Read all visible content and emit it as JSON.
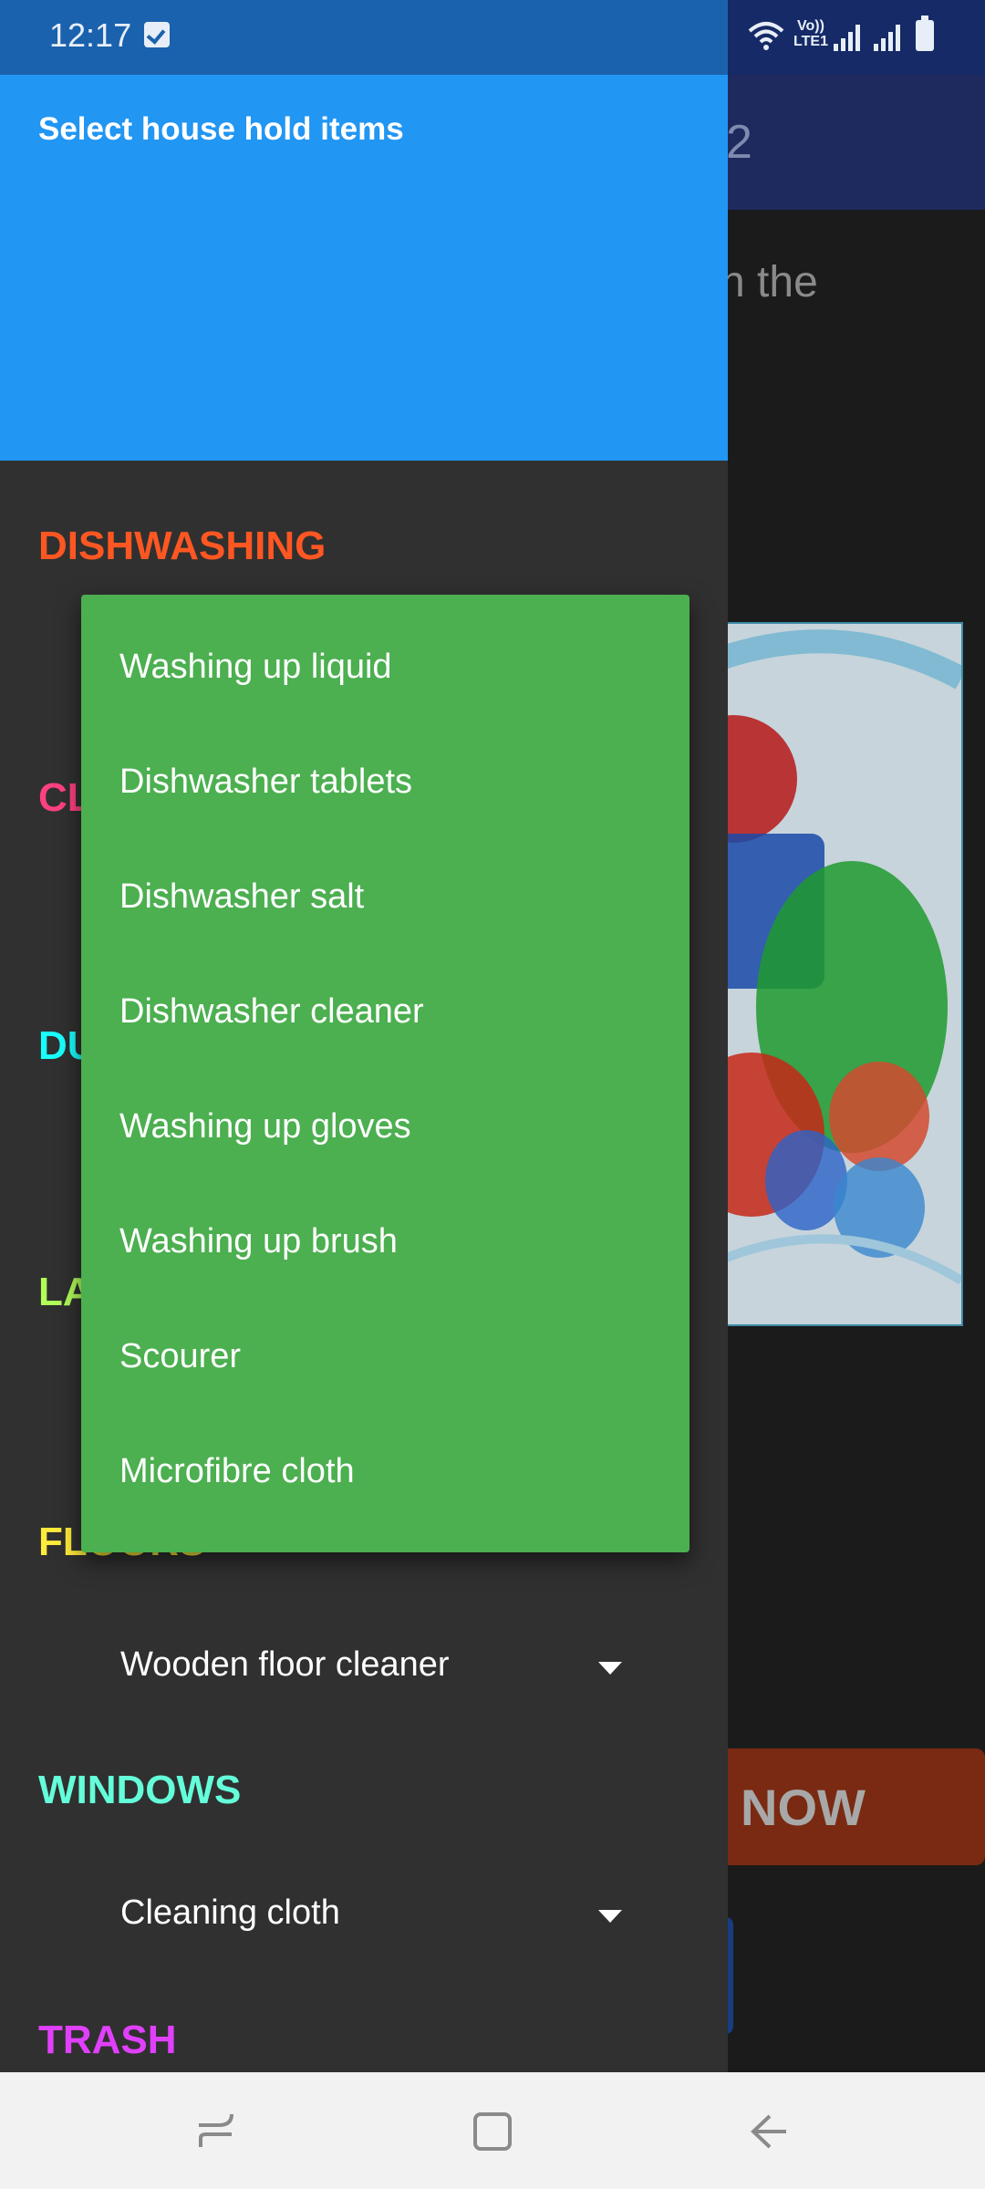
{
  "status_bar": {
    "time": "12:17",
    "network_label": "Vo)) LTE1",
    "icons": [
      "checkbox-notification-icon",
      "wifi-icon",
      "signal-icon",
      "signal-icon",
      "battery-icon"
    ]
  },
  "background_app": {
    "toolbar_title_fragment": "2",
    "body_text_fragment": "n the",
    "buy_button_fragment": "NOW"
  },
  "drawer": {
    "title": "Select house hold items",
    "sections": [
      {
        "label": "DISHWASHING",
        "color": "#ff5722"
      },
      {
        "label": "CL",
        "color": "#ff4081"
      },
      {
        "label": "DU",
        "color": "#18ffff"
      },
      {
        "label": "LA",
        "color": "#b2ff59"
      },
      {
        "label": "FLOORS",
        "color": "#ffeb3b",
        "selected": "Wooden floor cleaner"
      },
      {
        "label": "WINDOWS",
        "color": "#64ffda",
        "selected": "Cleaning cloth"
      },
      {
        "label": "TRASH",
        "color": "#e040fb"
      }
    ]
  },
  "dropdown": {
    "color": "#4caf50",
    "items": [
      "Washing up liquid",
      "Dishwasher tablets",
      "Dishwasher salt",
      "Dishwasher cleaner",
      "Washing up gloves",
      "Washing up brush",
      "Scourer",
      "Microfibre cloth"
    ]
  },
  "nav_bar": {
    "icons": [
      "recent-apps-icon",
      "home-icon",
      "back-icon"
    ]
  }
}
